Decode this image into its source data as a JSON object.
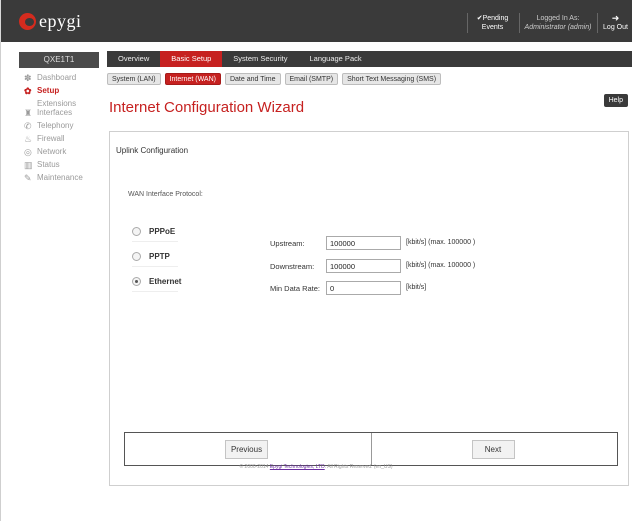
{
  "header": {
    "logo_text": "epygi",
    "pending_line1": "Pending",
    "pending_line2": "Events",
    "logged_line1": "Logged In As:",
    "logged_line2": "Administrator (admin)",
    "logout_label": "Log Out"
  },
  "sidebar": {
    "device": "QXE1T1",
    "items": [
      {
        "label": "Dashboard",
        "icon": "dashboard-icon"
      },
      {
        "label": "Setup",
        "sub": "Extensions",
        "icon": "gear-icon",
        "active": true
      },
      {
        "label": "Interfaces",
        "icon": "interfaces-icon"
      },
      {
        "label": "Telephony",
        "icon": "phone-icon"
      },
      {
        "label": "Firewall",
        "icon": "flame-icon"
      },
      {
        "label": "Network",
        "icon": "globe-icon"
      },
      {
        "label": "Status",
        "icon": "chart-icon"
      },
      {
        "label": "Maintenance",
        "icon": "wrench-icon"
      }
    ]
  },
  "tabs": [
    "Overview",
    "Basic Setup",
    "System Security",
    "Language Pack"
  ],
  "subtabs": [
    "System (LAN)",
    "Internet (WAN)",
    "Date and Time",
    "Email (SMTP)",
    "Short Text Messaging (SMS)"
  ],
  "help_label": "Help",
  "page_title": "Internet Configuration Wizard",
  "panel": {
    "heading": "Uplink Configuration",
    "protocol_label": "WAN Interface Protocol:",
    "protocols": [
      "PPPoE",
      "PPTP",
      "Ethernet"
    ],
    "selected_protocol": "Ethernet",
    "fields": {
      "upstream_label": "Upstream:",
      "upstream_value": "100000",
      "upstream_unit": "[kbit/s] (max. 100000 )",
      "downstream_label": "Downstream:",
      "downstream_value": "100000",
      "downstream_unit": "[kbit/s] (max. 100000 )",
      "mindata_label": "Min Data Rate:",
      "mindata_value": "0",
      "mindata_unit": "[kbit/s]"
    },
    "previous_label": "Previous",
    "next_label": "Next"
  },
  "footer": {
    "prefix": "© 2000-2014 ",
    "company": "Epygi Technologies, LTD",
    "suffix": ". All Rights Reserved. (en_US)"
  },
  "colors": {
    "accent": "#c62120",
    "dark": "#3a3a3a"
  }
}
